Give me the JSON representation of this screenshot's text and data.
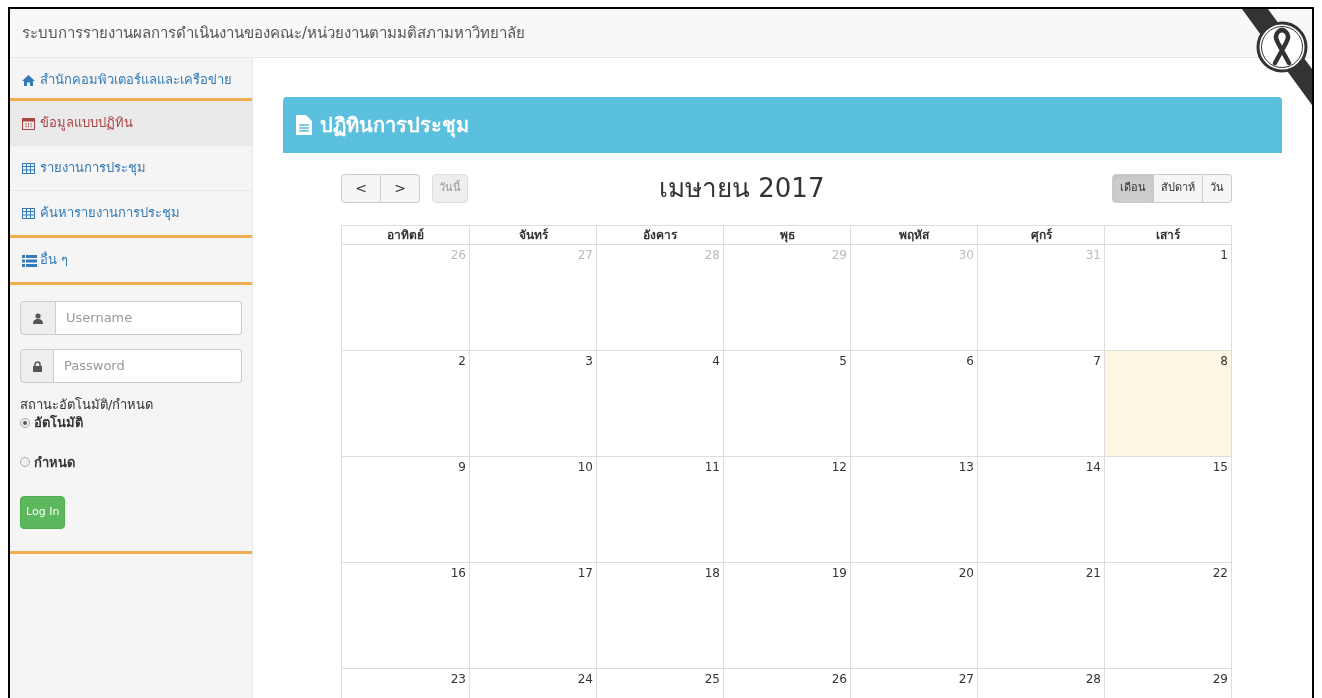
{
  "header": {
    "title": "ระบบการรายงานผลการดำเนินงานของคณะ/หน่วยงานตามมติสภามหาวิทยาลัย"
  },
  "sidebar": {
    "items": [
      {
        "kind": "home",
        "label": "สำนักคอมพิวเตอร์แลและเครือข่าย",
        "selected": false
      },
      {
        "kind": "calendar",
        "label": "ข้อมูลแบบปฏิทิน",
        "selected": true
      },
      {
        "kind": "table",
        "label": "รายงานการประชุม",
        "selected": false
      },
      {
        "kind": "table",
        "label": "ค้นหารายงานการประชุม",
        "selected": false
      },
      {
        "kind": "list",
        "label": "อื่น ๆ",
        "selected": false
      }
    ]
  },
  "login": {
    "username": {
      "placeholder": "Username"
    },
    "password": {
      "placeholder": "Password"
    },
    "mode_label": "สถานะอัตโนมัติ/กำหนด",
    "modes": [
      {
        "label": "อัตโนมัติ",
        "selected": true
      },
      {
        "label": "กำหนด",
        "selected": false
      }
    ],
    "button": "Log In"
  },
  "panel": {
    "title": "ปฏิทินการประชุม"
  },
  "calendar": {
    "prev": "<",
    "next": ">",
    "today_button": "วันนี้",
    "title": "เมษายน 2017",
    "views": [
      {
        "label": "เดือน",
        "selected": true
      },
      {
        "label": "สัปดาห์",
        "selected": false
      },
      {
        "label": "วัน",
        "selected": false
      }
    ],
    "weekdays": [
      "อาทิตย์",
      "จันทร์",
      "อังคาร",
      "พุธ",
      "พฤหัส",
      "ศุกร์",
      "เสาร์"
    ],
    "weeks": [
      [
        {
          "day": "26",
          "other_month": true,
          "today": false
        },
        {
          "day": "27",
          "other_month": true,
          "today": false
        },
        {
          "day": "28",
          "other_month": true,
          "today": false
        },
        {
          "day": "29",
          "other_month": true,
          "today": false
        },
        {
          "day": "30",
          "other_month": true,
          "today": false
        },
        {
          "day": "31",
          "other_month": true,
          "today": false
        },
        {
          "day": "1",
          "other_month": false,
          "today": false
        }
      ],
      [
        {
          "day": "2",
          "other_month": false,
          "today": false
        },
        {
          "day": "3",
          "other_month": false,
          "today": false
        },
        {
          "day": "4",
          "other_month": false,
          "today": false
        },
        {
          "day": "5",
          "other_month": false,
          "today": false
        },
        {
          "day": "6",
          "other_month": false,
          "today": false
        },
        {
          "day": "7",
          "other_month": false,
          "today": false
        },
        {
          "day": "8",
          "other_month": false,
          "today": true
        }
      ],
      [
        {
          "day": "9",
          "other_month": false,
          "today": false
        },
        {
          "day": "10",
          "other_month": false,
          "today": false
        },
        {
          "day": "11",
          "other_month": false,
          "today": false
        },
        {
          "day": "12",
          "other_month": false,
          "today": false
        },
        {
          "day": "13",
          "other_month": false,
          "today": false
        },
        {
          "day": "14",
          "other_month": false,
          "today": false
        },
        {
          "day": "15",
          "other_month": false,
          "today": false
        }
      ],
      [
        {
          "day": "16",
          "other_month": false,
          "today": false
        },
        {
          "day": "17",
          "other_month": false,
          "today": false
        },
        {
          "day": "18",
          "other_month": false,
          "today": false
        },
        {
          "day": "19",
          "other_month": false,
          "today": false
        },
        {
          "day": "20",
          "other_month": false,
          "today": false
        },
        {
          "day": "21",
          "other_month": false,
          "today": false
        },
        {
          "day": "22",
          "other_month": false,
          "today": false
        }
      ],
      [
        {
          "day": "23",
          "other_month": false,
          "today": false
        },
        {
          "day": "24",
          "other_month": false,
          "today": false
        },
        {
          "day": "25",
          "other_month": false,
          "today": false
        },
        {
          "day": "26",
          "other_month": false,
          "today": false
        },
        {
          "day": "27",
          "other_month": false,
          "today": false
        },
        {
          "day": "28",
          "other_month": false,
          "today": false
        },
        {
          "day": "29",
          "other_month": false,
          "today": false
        }
      ]
    ]
  }
}
